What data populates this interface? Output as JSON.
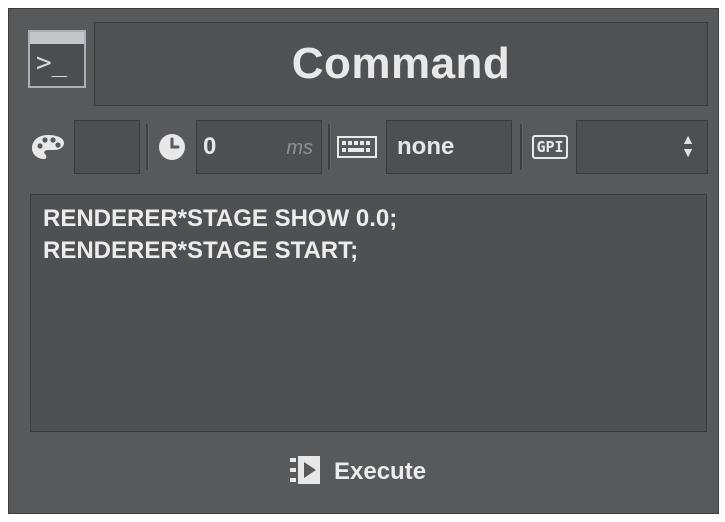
{
  "header": {
    "title": "Command",
    "icon": "terminal-icon",
    "prompt_glyph": ">_"
  },
  "toolbar": {
    "color_icon": "palette-icon",
    "color_swatch": "#58595b",
    "delay_icon": "clock-icon",
    "delay_value": "0",
    "delay_unit": "ms",
    "keyboard_icon": "keyboard-icon",
    "shortcut_value": "none",
    "gpi_icon": "gpi-icon",
    "gpi_label": "GPI",
    "gpi_value": ""
  },
  "editor": {
    "lines": [
      "RENDERER*STAGE SHOW 0.0;",
      "RENDERER*STAGE START;"
    ]
  },
  "actions": {
    "execute_label": "Execute",
    "execute_icon": "execute-icon"
  },
  "colors": {
    "panel_bg": "#58595b",
    "field_bg": "#4e4f52",
    "text": "#ececec"
  }
}
